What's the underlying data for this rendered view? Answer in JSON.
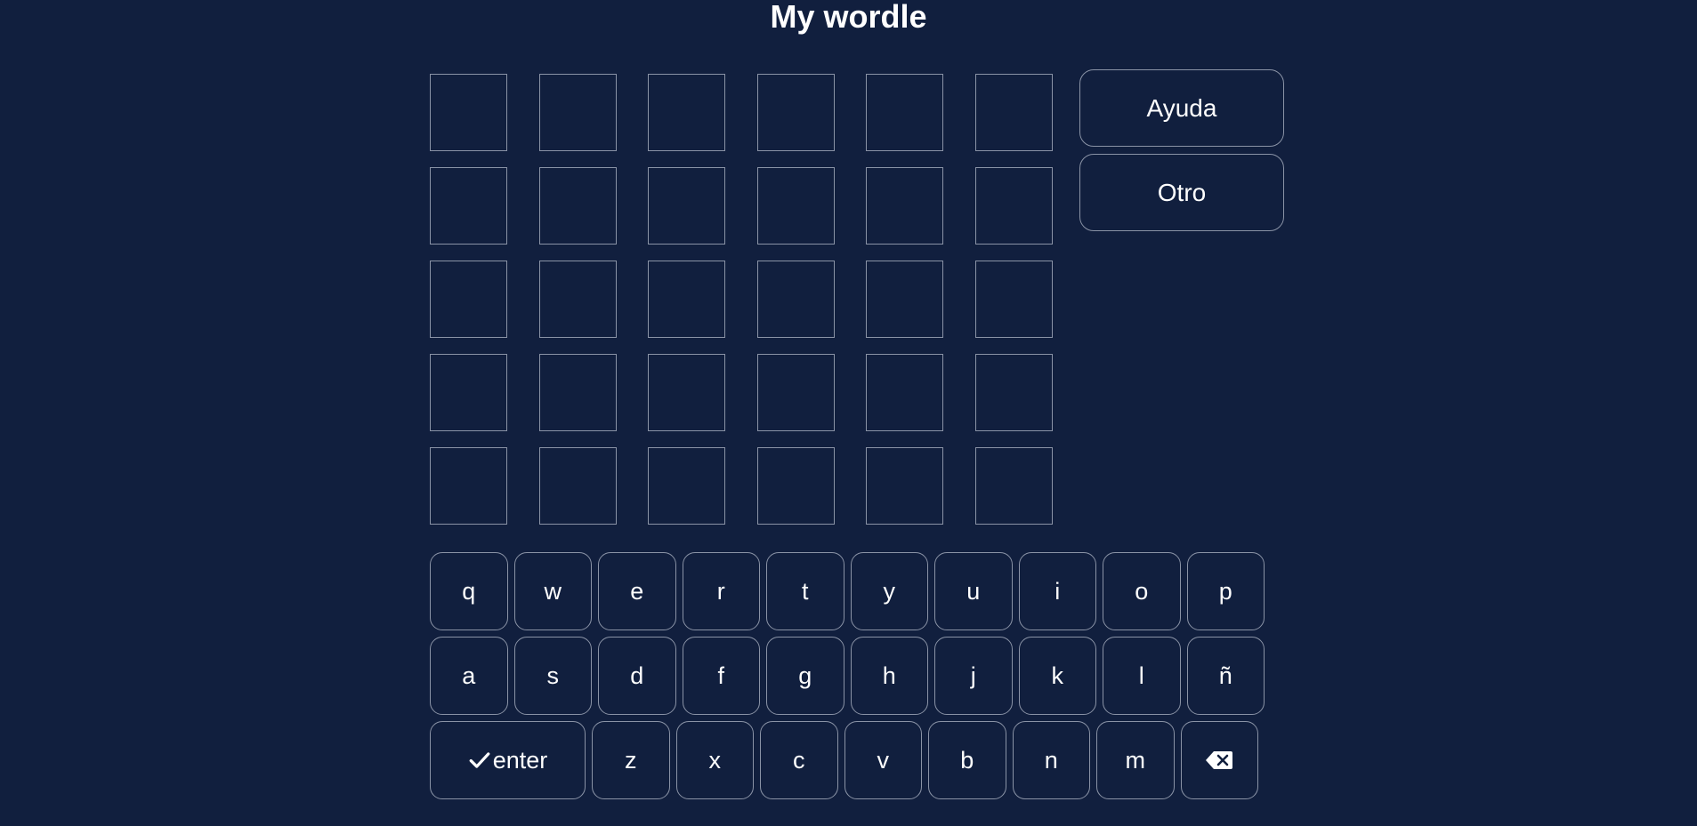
{
  "title": "My wordle",
  "side_buttons": {
    "help_label": "Ayuda",
    "other_label": "Otro"
  },
  "board": {
    "rows": [
      [
        "",
        "",
        "",
        "",
        "",
        ""
      ],
      [
        "",
        "",
        "",
        "",
        "",
        ""
      ],
      [
        "",
        "",
        "",
        "",
        "",
        ""
      ],
      [
        "",
        "",
        "",
        "",
        "",
        ""
      ],
      [
        "",
        "",
        "",
        "",
        "",
        ""
      ]
    ]
  },
  "keyboard": {
    "row1": [
      "q",
      "w",
      "e",
      "r",
      "t",
      "y",
      "u",
      "i",
      "o",
      "p"
    ],
    "row2": [
      "a",
      "s",
      "d",
      "f",
      "g",
      "h",
      "j",
      "k",
      "l",
      "ñ"
    ],
    "row3": [
      "z",
      "x",
      "c",
      "v",
      "b",
      "n",
      "m"
    ],
    "enter_label": "enter",
    "enter_icon": "check-icon",
    "backspace_icon": "backspace-icon"
  },
  "colors": {
    "background": "#111f3e",
    "border": "#8a93a6",
    "text": "#ffffff"
  }
}
